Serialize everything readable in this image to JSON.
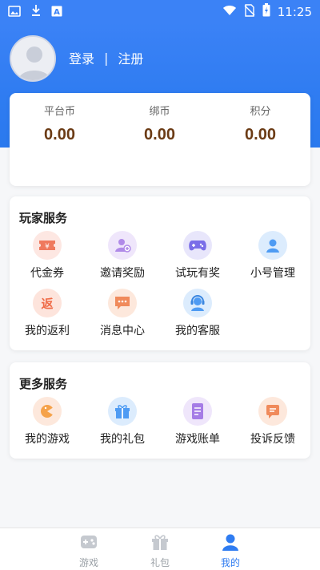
{
  "status_bar": {
    "time": "11:25",
    "icons": [
      "image-icon",
      "download-icon",
      "app-a-icon",
      "wifi-icon",
      "no-sim-icon",
      "battery-charging-icon"
    ]
  },
  "header": {
    "login_label": "登录",
    "separator": "|",
    "register_label": "注册"
  },
  "wallet": [
    {
      "label": "平台币",
      "value": "0.00"
    },
    {
      "label": "绑币",
      "value": "0.00"
    },
    {
      "label": "积分",
      "value": "0.00"
    }
  ],
  "player_services": {
    "title": "玩家服务",
    "items": [
      {
        "label": "代金券",
        "icon": "voucher-icon"
      },
      {
        "label": "邀请奖励",
        "icon": "invite-reward-icon"
      },
      {
        "label": "试玩有奖",
        "icon": "gamepad-icon"
      },
      {
        "label": "小号管理",
        "icon": "account-icon"
      },
      {
        "label": "我的返利",
        "icon": "rebate-icon",
        "glyph": "返"
      },
      {
        "label": "消息中心",
        "icon": "message-icon"
      },
      {
        "label": "我的客服",
        "icon": "customer-service-icon"
      }
    ]
  },
  "more_services": {
    "title": "更多服务",
    "items": [
      {
        "label": "我的游戏",
        "icon": "my-game-icon"
      },
      {
        "label": "我的礼包",
        "icon": "gift-icon"
      },
      {
        "label": "游戏账单",
        "icon": "bill-icon"
      },
      {
        "label": "投诉反馈",
        "icon": "feedback-icon"
      }
    ]
  },
  "tabbar": {
    "tabs": [
      {
        "label": "游戏",
        "icon": "game-tab-icon",
        "active": false
      },
      {
        "label": "礼包",
        "icon": "gift-tab-icon",
        "active": false
      },
      {
        "label": "我的",
        "icon": "profile-tab-icon",
        "active": true
      }
    ]
  },
  "colors": {
    "primary": "#3b82f6",
    "wallet_value": "#6b3b15",
    "tab_inactive": "#9aa0a6",
    "tab_active": "#2f7cf1"
  }
}
